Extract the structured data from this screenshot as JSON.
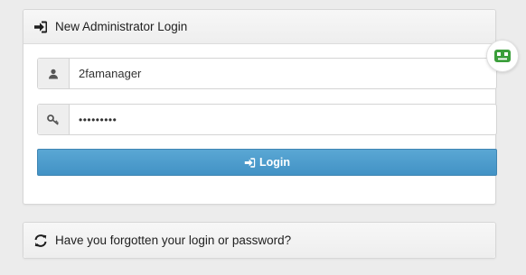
{
  "login_panel": {
    "title": "New Administrator Login",
    "title_icon": "sign-in-icon",
    "username": {
      "value": "2famanager",
      "icon": "user-icon"
    },
    "password": {
      "value": "•••••••••",
      "icon": "key-icon"
    },
    "login_button": {
      "label": "Login",
      "icon": "sign-in-icon"
    }
  },
  "extension_badge": {
    "icon": "robot-face-icon",
    "color": "#3a9e3a"
  },
  "forgot_panel": {
    "title": "Have you forgotten your login or password?",
    "icon": "refresh-icon"
  },
  "colors": {
    "button": "#4a9ccc",
    "background": "#ececec",
    "panel_border": "#d7d7d7"
  }
}
